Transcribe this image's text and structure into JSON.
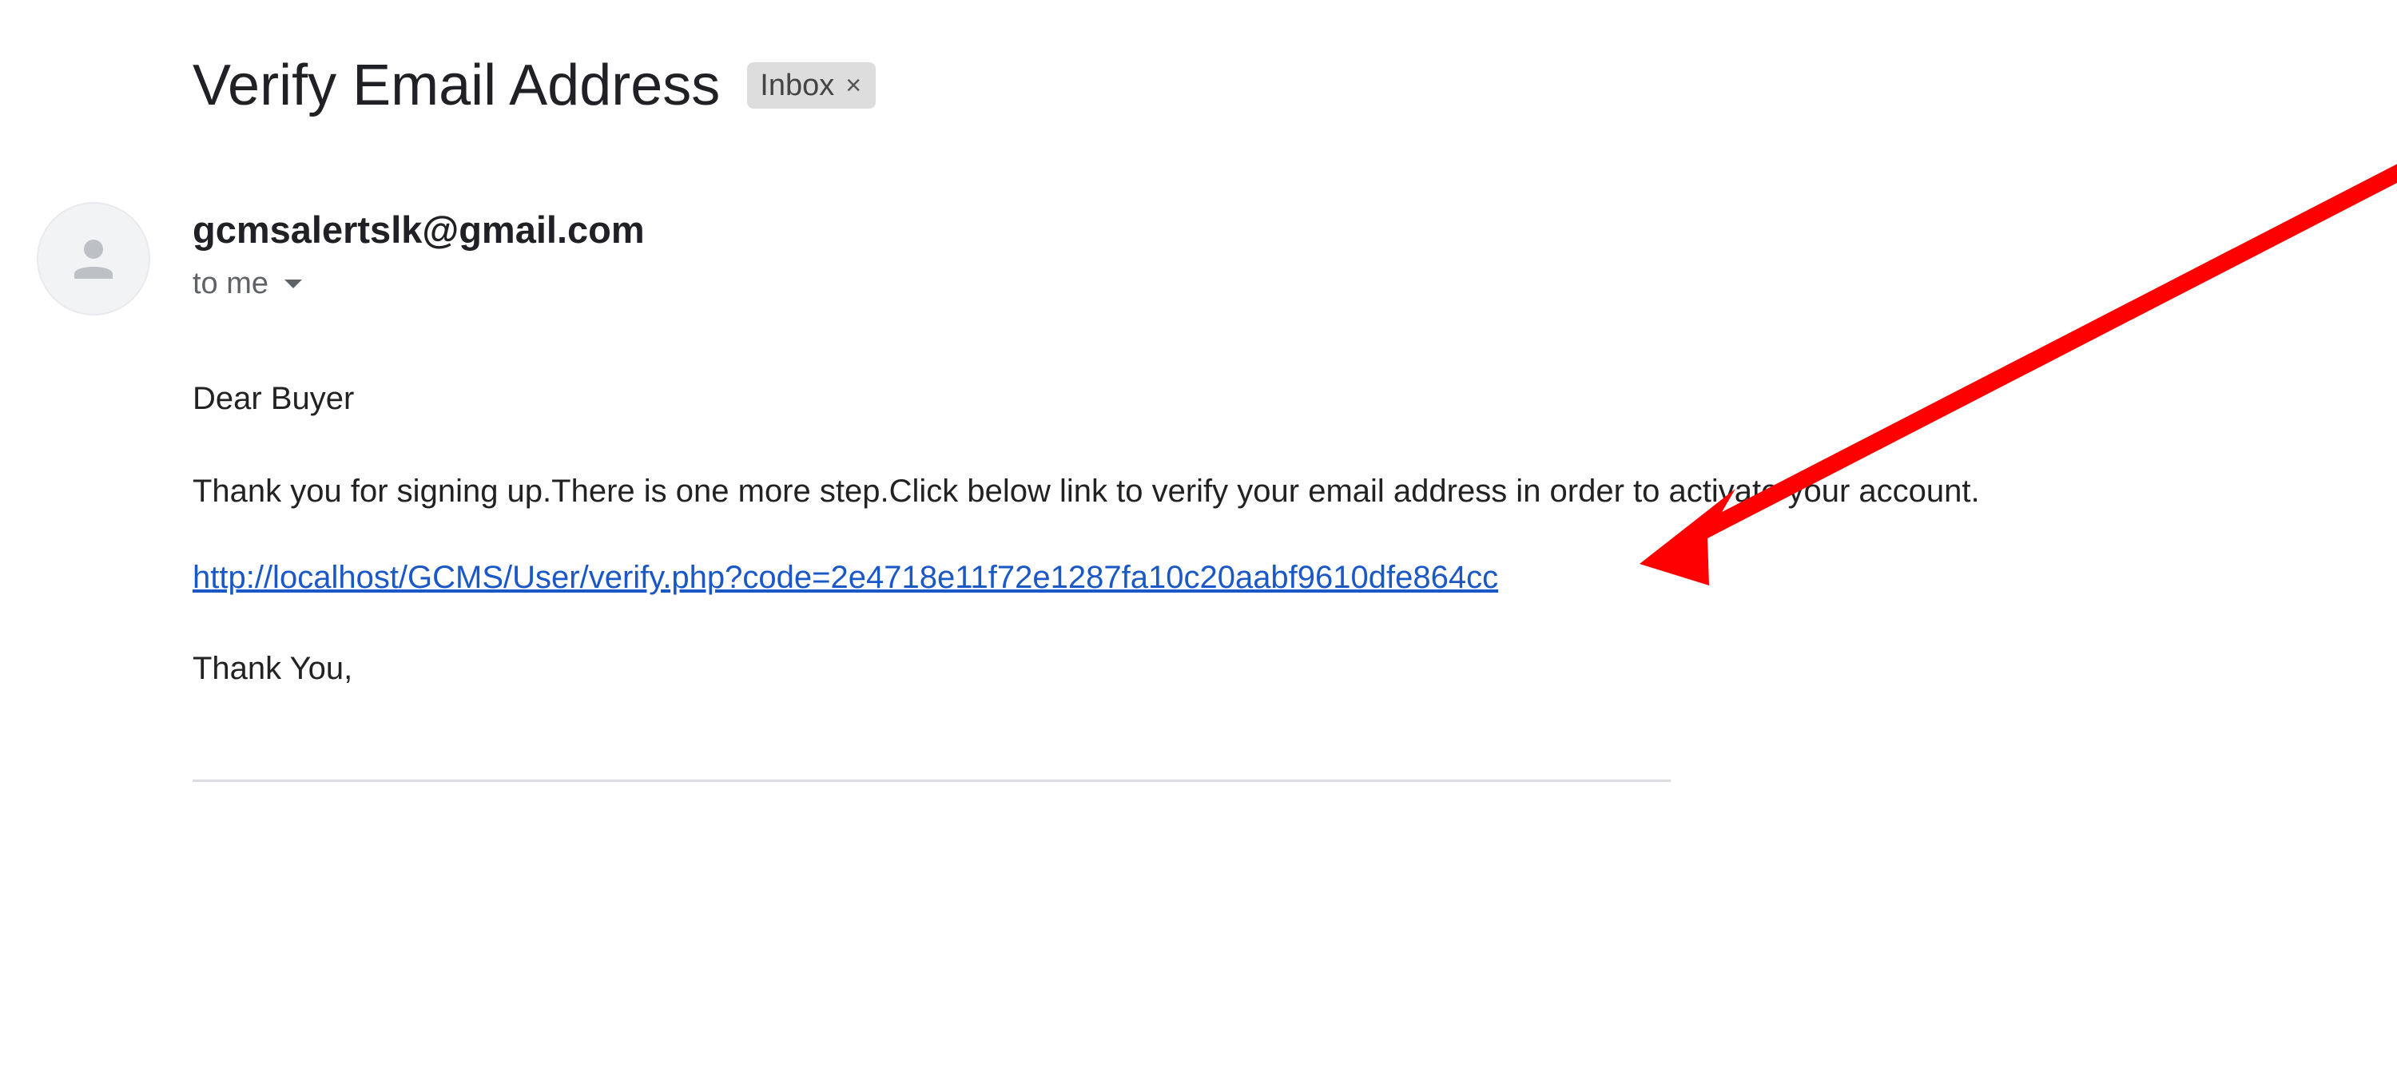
{
  "email": {
    "subject": "Verify Email Address",
    "label_chip": {
      "label": "Inbox",
      "close_glyph": "×"
    },
    "sender": "gcmsalertslk@gmail.com",
    "recipient": "to me",
    "avatar_icon": "person-icon",
    "body": {
      "greeting": "Dear Buyer",
      "message": "Thank you for signing up.There is one more step.Click below link to verify your email address in order to activate your account.",
      "link": "http://localhost/GCMS/User/verify.php?code=2e4718e11f72e1287fa10c20aabf9610dfe864cc",
      "signoff": "Thank You,"
    }
  },
  "annotation": {
    "type": "arrow",
    "icon": "red-arrow-icon",
    "color": "#ff0000"
  },
  "colors": {
    "link": "#1a57c7",
    "chip_background": "#dddddd",
    "divider": "#dadce0"
  }
}
